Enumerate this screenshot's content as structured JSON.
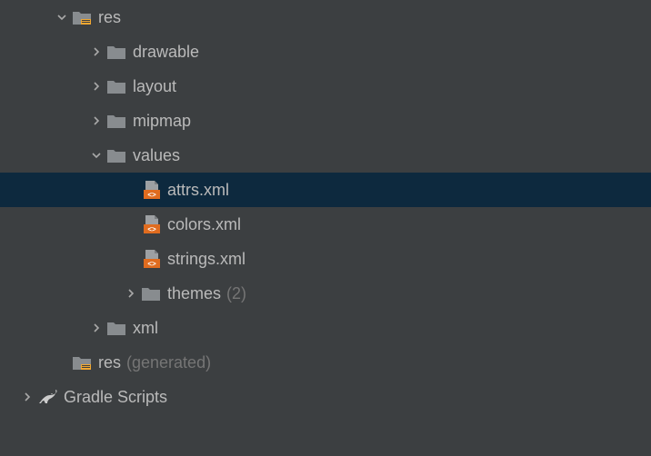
{
  "tree": {
    "res": {
      "label": "res"
    },
    "drawable": {
      "label": "drawable"
    },
    "layout": {
      "label": "layout"
    },
    "mipmap": {
      "label": "mipmap"
    },
    "values": {
      "label": "values"
    },
    "attrs": {
      "label": "attrs.xml"
    },
    "colors": {
      "label": "colors.xml"
    },
    "strings": {
      "label": "strings.xml"
    },
    "themes": {
      "label": "themes",
      "suffix": "(2)"
    },
    "xml": {
      "label": "xml"
    },
    "res_gen": {
      "label": "res",
      "suffix": "(generated)"
    },
    "gradle": {
      "label": "Gradle Scripts"
    }
  }
}
